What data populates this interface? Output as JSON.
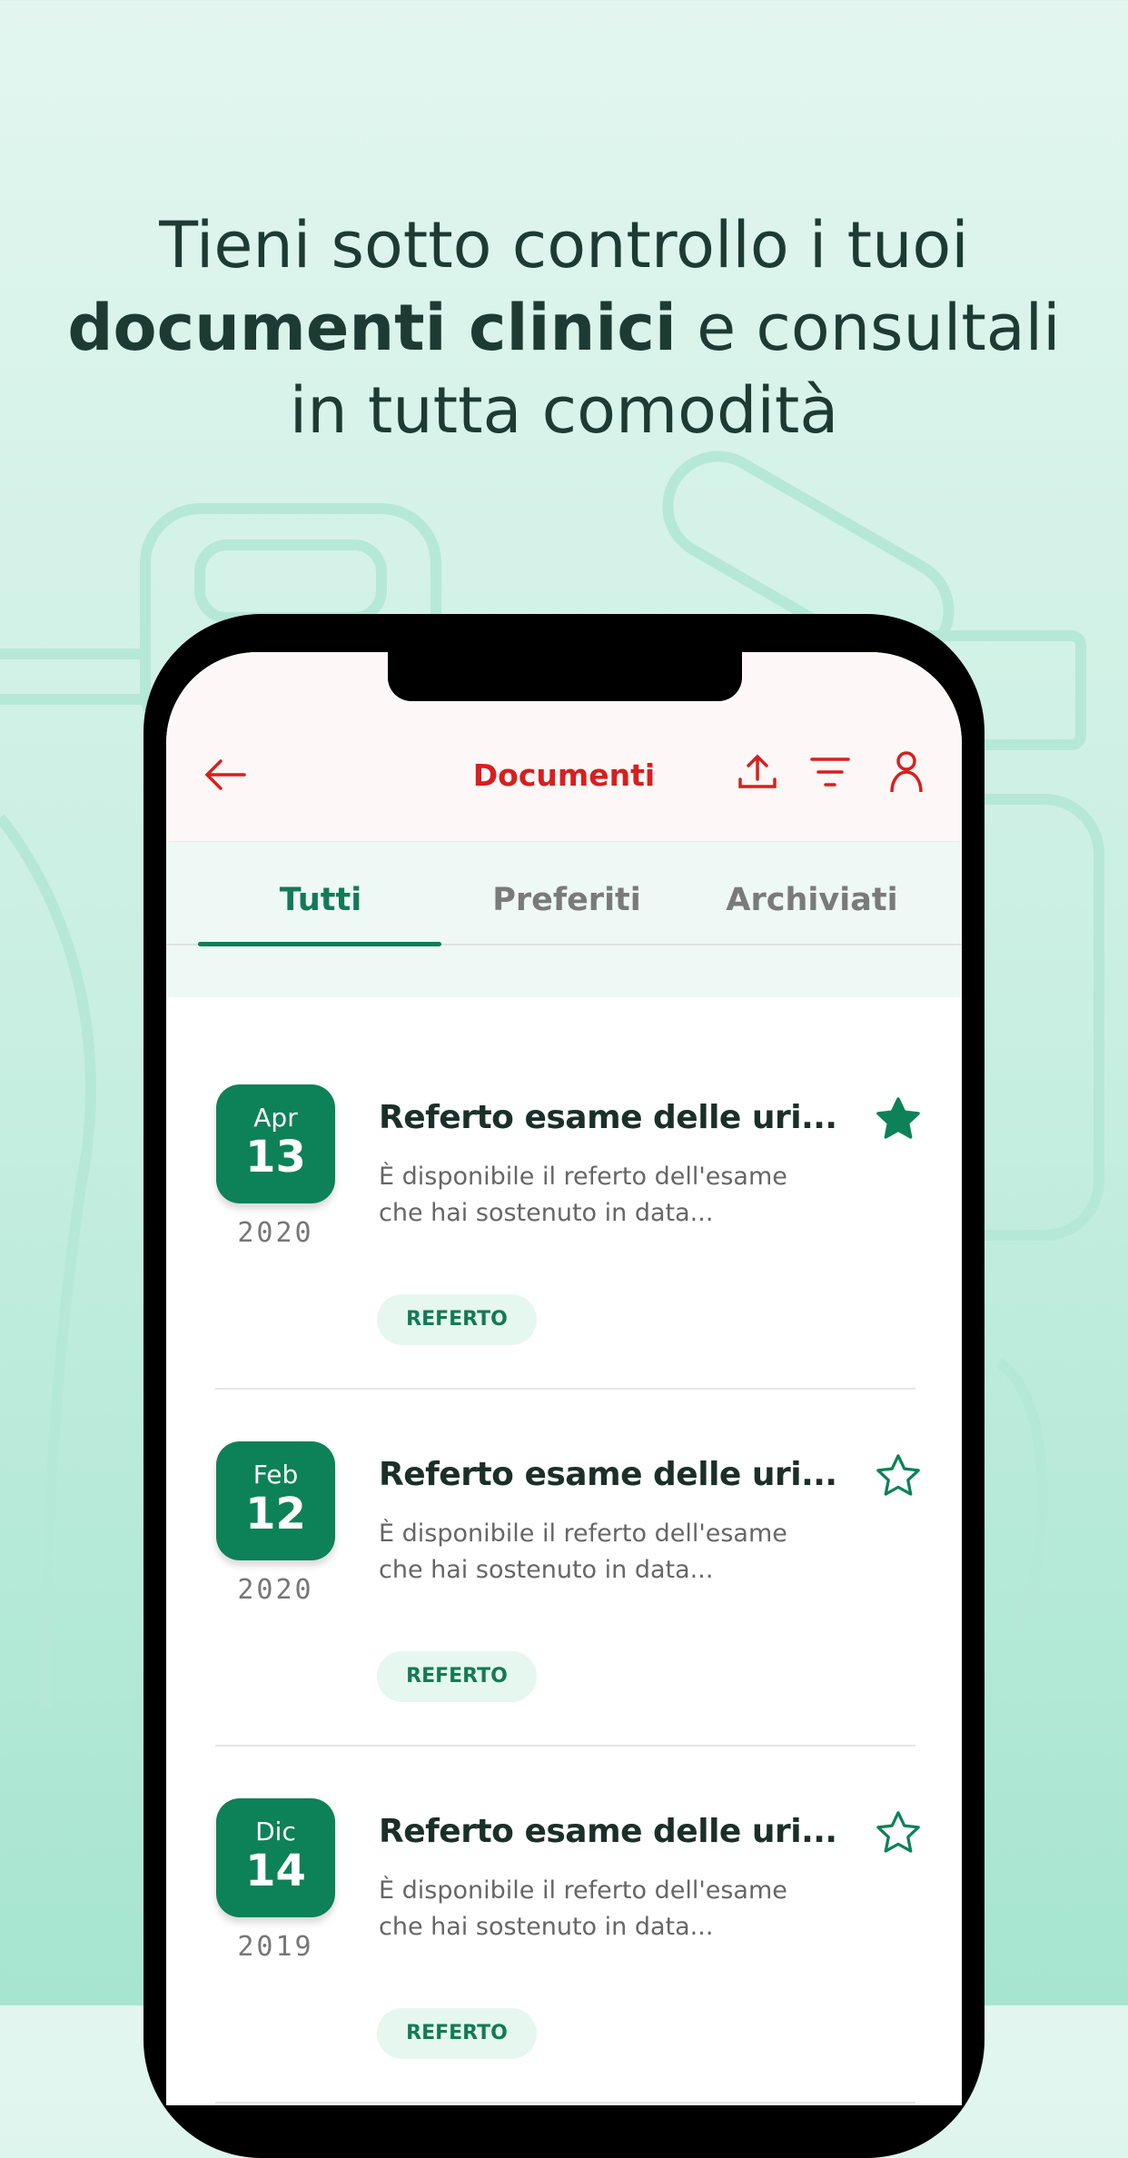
{
  "headline": {
    "line1": "Tieni sotto controllo i tuoi",
    "bold": "documenti clinici",
    "line2_rest": " e consultali",
    "line3": "in tutta comodità"
  },
  "header": {
    "title": "Documenti",
    "icons": [
      "arrow-left-icon",
      "upload-icon",
      "filter-icon",
      "user-icon"
    ],
    "color": "#d81f1f"
  },
  "tabs": [
    {
      "label": "Tutti",
      "active": true
    },
    {
      "label": "Preferiti",
      "active": false
    },
    {
      "label": "Archiviati",
      "active": false
    }
  ],
  "accent": "#0d8158",
  "documents": [
    {
      "month": "Apr",
      "day": "13",
      "year": "2020",
      "title": "Referto esame delle uri...",
      "description_1": "È disponibile il referto dell'esame",
      "description_2": "che hai sostenuto in data...",
      "tag": "REFERTO",
      "favorite": true
    },
    {
      "month": "Feb",
      "day": "12",
      "year": "2020",
      "title": "Referto esame delle uri...",
      "description_1": "È disponibile il referto dell'esame",
      "description_2": "che hai sostenuto in data...",
      "tag": "REFERTO",
      "favorite": false
    },
    {
      "month": "Dic",
      "day": "14",
      "year": "2019",
      "title": "Referto esame delle uri...",
      "description_1": "È disponibile il referto dell'esame",
      "description_2": "che hai sostenuto in data...",
      "tag": "REFERTO",
      "favorite": false
    }
  ]
}
